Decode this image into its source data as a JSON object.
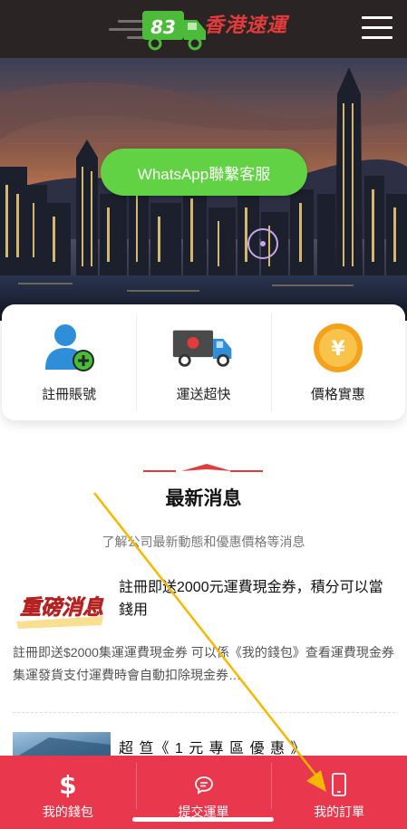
{
  "header": {
    "logo_number": "83",
    "logo_text": "香港速運",
    "menu_icon": "hamburger-menu-icon"
  },
  "hero": {
    "whatsapp_label": "WhatsApp聯繫客服"
  },
  "features": [
    {
      "label": "註冊賬號",
      "icon": "user-add-icon"
    },
    {
      "label": "運送超快",
      "icon": "delivery-truck-icon"
    },
    {
      "label": "價格實惠",
      "icon": "yen-coin-icon"
    }
  ],
  "news": {
    "title": "最新消息",
    "subtitle": "了解公司最新動態和優惠價格等消息",
    "items": [
      {
        "thumb_text": "重磅消息",
        "title": "註冊即送2000元運費現金券，積分可以當錢用",
        "desc": "註冊即送$2000集運運費現金券 可以係《我的錢包》查看運費現金券 集運發貨支付運費時會自動扣除現金券…"
      },
      {
        "title": "超 笪《 1 元 專 區 優 惠 》"
      }
    ]
  },
  "bottom_nav": [
    {
      "label": "我的錢包",
      "icon": "dollar-icon"
    },
    {
      "label": "提交運單",
      "icon": "chat-bubble-icon"
    },
    {
      "label": "我的訂單",
      "icon": "phone-icon"
    }
  ],
  "colors": {
    "accent_red": "#e9374d",
    "whatsapp_green": "#62d245",
    "header_bg": "#2a2524",
    "overlay_arrow": "#f5b800"
  }
}
